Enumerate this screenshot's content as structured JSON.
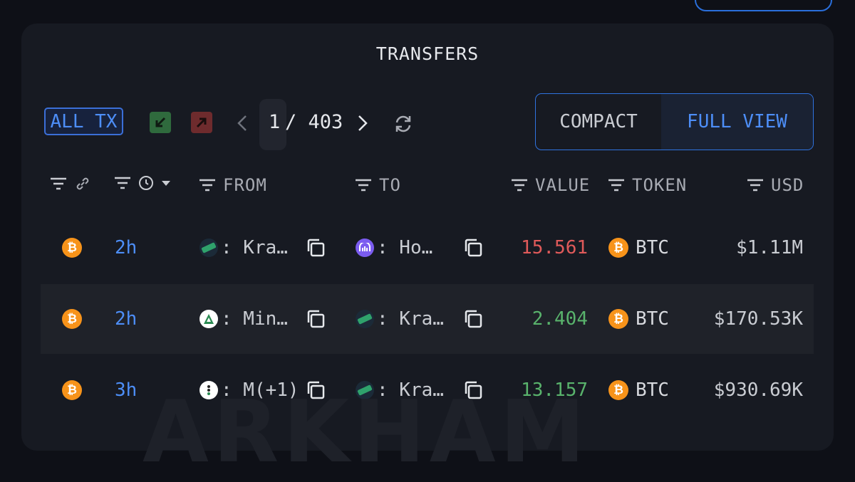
{
  "panel": {
    "title": "TRANSFERS"
  },
  "toolbar": {
    "all_tx_label": "ALL TX",
    "page_current": "1",
    "page_total": "/ 403",
    "view_compact": "COMPACT",
    "view_full": "FULL VIEW",
    "active_view": "FULL VIEW"
  },
  "columns": {
    "from": "FROM",
    "to": "TO",
    "value": "VALUE",
    "token": "TOKEN",
    "usd": "USD"
  },
  "rows": [
    {
      "chain_icon": "bitcoin-icon",
      "time": "2h",
      "from": ": Kra…",
      "from_icon": "kraken-icon",
      "to": ": Ho…",
      "to_icon": "kucoin-icon",
      "value": "15.561",
      "value_color": "#e05a5a",
      "token": "BTC",
      "usd": "$1.11M"
    },
    {
      "chain_icon": "bitcoin-icon",
      "time": "2h",
      "from": ": Min…",
      "from_icon": "mining-pool-icon",
      "to": ": Kra…",
      "to_icon": "kraken-icon",
      "value": "2.404",
      "value_color": "#59b36c",
      "token": "BTC",
      "usd": "$170.53K"
    },
    {
      "chain_icon": "bitcoin-icon",
      "time": "3h",
      "from": ": M(+1)",
      "from_icon": "multi-entity-icon",
      "to": ": Kra…",
      "to_icon": "kraken-icon",
      "value": "13.157",
      "value_color": "#59b36c",
      "token": "BTC",
      "usd": "$930.69K"
    }
  ],
  "watermark": "ARKHAM",
  "colors": {
    "accent": "#4d8ef7",
    "in": "#2f6a3d",
    "out": "#6e2b2d",
    "btc": "#f7931a"
  }
}
